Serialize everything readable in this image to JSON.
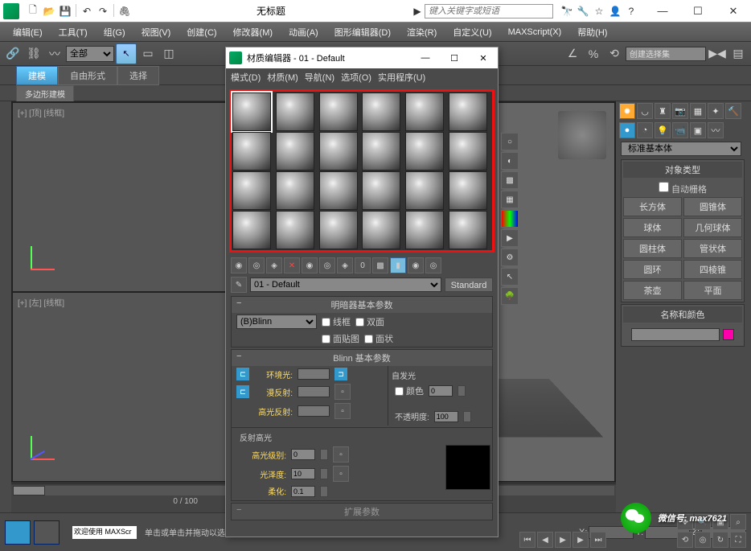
{
  "titlebar": {
    "title": "无标题",
    "search_placeholder": "键入关键字或短语"
  },
  "win": {
    "min": "—",
    "max": "☐",
    "close": "✕"
  },
  "menubar": [
    "编辑(E)",
    "工具(T)",
    "组(G)",
    "视图(V)",
    "创建(C)",
    "修改器(M)",
    "动画(A)",
    "图形编辑器(D)",
    "渲染(R)",
    "自定义(U)",
    "MAXScript(X)",
    "帮助(H)"
  ],
  "toolbar": {
    "all": "全部",
    "selset": "创建选择集"
  },
  "ribbon": {
    "tabs": [
      "建模",
      "自由形式",
      "选择"
    ],
    "subtab": "多边形建模"
  },
  "viewport": {
    "tl_label": "[+] [顶] [线框]",
    "bl_label": "[+] [左] [线框]"
  },
  "timeline": {
    "readout": "0 / 100"
  },
  "status": {
    "welcome": "欢迎使用 MAXScr",
    "hint": "单击或单击并拖动以选择对象",
    "x": "X:",
    "y": "Y:",
    "z": "Z:"
  },
  "rightpanel": {
    "dropdown": "标准基本体",
    "sect1_title": "对象类型",
    "autogrid": "自动栅格",
    "prims": [
      "长方体",
      "圆锥体",
      "球体",
      "几何球体",
      "圆柱体",
      "管状体",
      "圆环",
      "四棱锥",
      "茶壶",
      "平面"
    ],
    "sect2_title": "名称和颜色"
  },
  "mateditor": {
    "title": "材质编辑器 - 01 - Default",
    "menu": [
      "模式(D)",
      "材质(M)",
      "导航(N)",
      "选项(O)",
      "实用程序(U)"
    ],
    "name": "01 - Default",
    "type": "Standard",
    "panel1": "明暗器基本参数",
    "shader": "(B)Blinn",
    "chk_wire": "线框",
    "chk_2side": "双面",
    "chk_facemap": "面贴图",
    "chk_faceted": "面状",
    "panel2": "Blinn 基本参数",
    "selfillum": "自发光",
    "selfillum_color": "颜色",
    "selfillum_val": "0",
    "ambient": "环境光:",
    "diffuse": "漫反射:",
    "specular": "高光反射:",
    "opacity": "不透明度:",
    "opacity_val": "100",
    "spec_section": "反射高光",
    "spec_level": "高光级别:",
    "spec_level_val": "0",
    "gloss": "光泽度:",
    "gloss_val": "10",
    "soften": "柔化:",
    "soften_val": "0.1",
    "panel3": "扩展参数"
  },
  "watermark": "微信号: max7621"
}
